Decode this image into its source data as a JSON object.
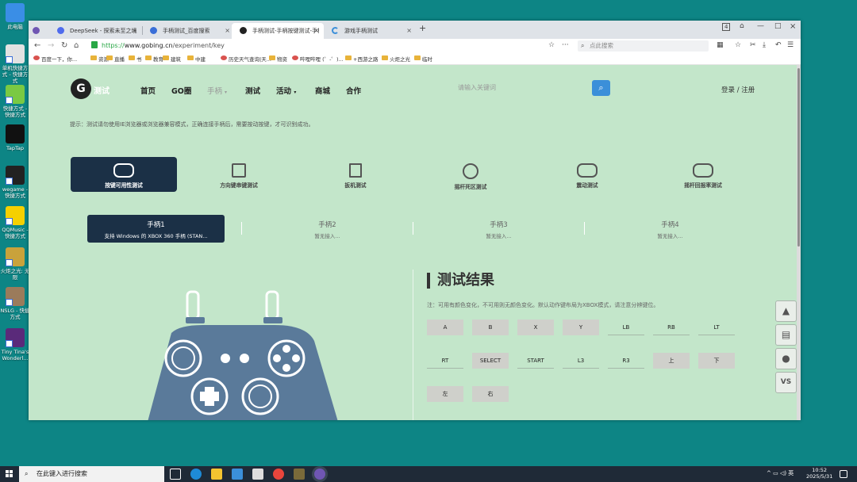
{
  "desktop": {
    "icons": [
      {
        "label": "此电脑",
        "color": "#3a8ee6"
      },
      {
        "label": "单机快捷方式 - 快捷方式",
        "color": "#e2e2e2"
      },
      {
        "label": "快捷方式 - 快捷方式",
        "color": "#7ac943"
      },
      {
        "label": "TapTap",
        "color": "#111111"
      },
      {
        "label": "wegame - 快捷方式",
        "color": "#222222"
      },
      {
        "label": "QQMusic - 快捷方式",
        "color": "#f5d000"
      },
      {
        "label": "火炬之光: 无限",
        "color": "#c9a23b"
      },
      {
        "label": "NSLG - 快捷方式",
        "color": "#9b7b5b"
      },
      {
        "label": "Tiny Tina's Wonderl...",
        "color": "#5a2a7a"
      }
    ]
  },
  "browser": {
    "tabs": [
      {
        "title": "DeepSeek - 探索未至之境",
        "fav": "#4f6bed"
      },
      {
        "title": "手柄测试_百度搜索",
        "fav": "#3a6fd8"
      },
      {
        "title": "手柄测试-手柄按键测试-手柄",
        "fav": "#222222"
      },
      {
        "title": "游戏手柄测试",
        "fav": "#3b8fd9"
      }
    ],
    "new_tab": "+",
    "tab_count": "4",
    "url": {
      "scheme": "https://",
      "host": "www.gobing.cn",
      "path": "/experiment/key"
    },
    "search_placeholder": "点此搜索",
    "bookmarks": [
      "百度一下，你...",
      "资源",
      "直播",
      "书",
      "教育",
      "建筑",
      "中建",
      "历史天气查询|天...",
      "物资",
      "哔哩哔哩 (゜-゜)...",
      "+西游之路",
      "火炬之光",
      "临时"
    ]
  },
  "site": {
    "logo_text": "测试",
    "nav": [
      "首页",
      "GO圈",
      "手柄",
      "测试",
      "活动",
      "商城",
      "合作"
    ],
    "search_placeholder": "请输入关键词",
    "login": "登录 / 注册",
    "tip": "提示：测试请勿使用IE浏览器或浏览器兼容模式，正确连接手柄后，需要按动按键，才可识别成功。",
    "test_buttons": [
      "按键可用性测试",
      "方向键串键测试",
      "扳机测试",
      "摇杆死区测试",
      "震动测试",
      "摇杆回报率测试"
    ],
    "gamepads": [
      {
        "name": "手柄1",
        "status": "支持 Windows 的 XBOX 360 手柄 (STAN..."
      },
      {
        "name": "手柄2",
        "status": "暂无接入..."
      },
      {
        "name": "手柄3",
        "status": "暂无接入..."
      },
      {
        "name": "手柄4",
        "status": "暂无接入..."
      }
    ],
    "result_title": "测试结果",
    "result_note": "注：可用有颜色变化，不可用则无颜色变化。默认动作键布局为XBOX模式，请注意分辨键位。",
    "keys": [
      {
        "label": "A",
        "on": true
      },
      {
        "label": "B",
        "on": true
      },
      {
        "label": "X",
        "on": true
      },
      {
        "label": "Y",
        "on": true
      },
      {
        "label": "LB",
        "on": false
      },
      {
        "label": "RB",
        "on": false
      },
      {
        "label": "LT",
        "on": false
      },
      {
        "label": "RT",
        "on": false
      },
      {
        "label": "SELECT",
        "on": true
      },
      {
        "label": "START",
        "on": false
      },
      {
        "label": "L3",
        "on": false
      },
      {
        "label": "R3",
        "on": false
      },
      {
        "label": "上",
        "on": true
      },
      {
        "label": "下",
        "on": true
      },
      {
        "label": "左",
        "on": true
      },
      {
        "label": "右",
        "on": true
      }
    ],
    "side_tools": [
      "rocket-icon",
      "clipboard-icon",
      "wechat-icon",
      "vs-icon"
    ],
    "side_vs_label": "VS"
  },
  "taskbar": {
    "search_placeholder": "在此键入进行搜索",
    "time": "10:52",
    "date": "2025/5/31",
    "ime": "英"
  }
}
